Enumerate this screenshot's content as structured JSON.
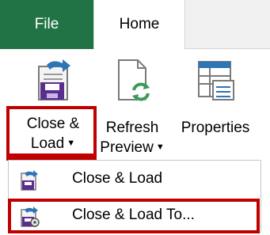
{
  "tabs": {
    "file": "File",
    "home": "Home"
  },
  "ribbon": {
    "close_load": {
      "line1": "Close &",
      "line2": "Load",
      "icon": "close-load-icon"
    },
    "refresh_preview": {
      "line1": "Refresh",
      "line2": "Preview",
      "icon": "refresh-icon"
    },
    "properties": {
      "line1": "Properties",
      "icon": "properties-icon"
    }
  },
  "menu": {
    "items": [
      {
        "label": "Close & Load",
        "icon": "close-load-small-icon"
      },
      {
        "label": "Close & Load To...",
        "icon": "close-load-to-icon"
      }
    ]
  },
  "colors": {
    "file_tab": "#217346",
    "highlight": "#cfe3d5",
    "callout_border": "#c00000"
  }
}
